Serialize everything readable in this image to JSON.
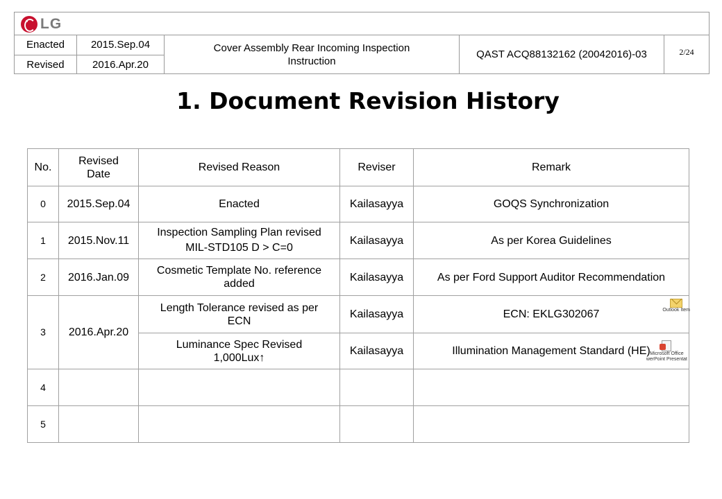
{
  "header": {
    "logo_text": "LG",
    "enacted_label": "Enacted",
    "enacted_date": "2015.Sep.04",
    "revised_label": "Revised",
    "revised_date": "2016.Apr.20",
    "doc_title": "Cover Assembly Rear Incoming Inspection Instruction",
    "doc_code": "QAST ACQ88132162 (20042016)-03",
    "page_number": "2/24"
  },
  "title": "1. Document Revision History",
  "table": {
    "headers": {
      "no": "No.",
      "date": "Revised Date",
      "reason": "Revised Reason",
      "reviser": "Reviser",
      "remark": "Remark"
    },
    "rows": [
      {
        "no": "0",
        "date": "2015.Sep.04",
        "reason_line1": "Enacted",
        "reason_line2": "",
        "reviser": "Kailasayya",
        "remark": "GOQS Synchronization"
      },
      {
        "no": "1",
        "date": "2015.Nov.11",
        "reason_line1": "Inspection Sampling Plan revised",
        "reason_line2": "MIL-STD105 D > C=0",
        "reviser": "Kailasayya",
        "remark": "As per Korea Guidelines"
      },
      {
        "no": "2",
        "date": "2016.Jan.09",
        "reason_line1": "Cosmetic Template No. reference",
        "reason_line2": "added",
        "reviser": "Kailasayya",
        "remark": "As per Ford Support Auditor Recommendation"
      },
      {
        "no": "3",
        "date": "2016.Apr.20",
        "reason_line1": "Length Tolerance revised as per",
        "reason_line2": "ECN",
        "reviser": "Kailasayya",
        "remark": "ECN: EKLG302067"
      },
      {
        "no": "",
        "date": "",
        "reason_line1": "Luminance Spec Revised",
        "reason_line2": "1,000Lux↑",
        "reviser": "Kailasayya",
        "remark": "Illumination Management Standard (HE)"
      },
      {
        "no": "4",
        "date": "",
        "reason_line1": "",
        "reason_line2": "",
        "reviser": "",
        "remark": ""
      },
      {
        "no": "5",
        "date": "",
        "reason_line1": "",
        "reason_line2": "",
        "reviser": "",
        "remark": ""
      }
    ],
    "attachments": {
      "outlook_label": "Outlook Item",
      "ppt_label_1": "Microsoft Office",
      "ppt_label_2": "werPoint Presentat"
    }
  }
}
